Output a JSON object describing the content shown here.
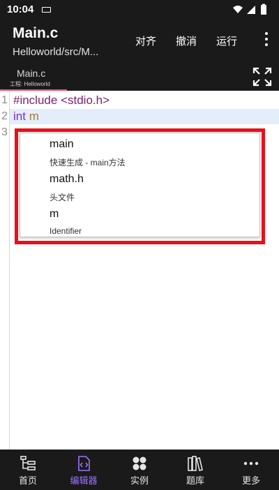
{
  "status_bar": {
    "time": "10:04"
  },
  "app_bar": {
    "title": "Main.c",
    "subtitle": "Helloworld/src/M...",
    "actions": {
      "format": "对齐",
      "undo": "撤消",
      "run": "运行"
    }
  },
  "tabs": [
    {
      "name": "Main.c",
      "project": "工程: Helloworld"
    }
  ],
  "editor": {
    "lines": [
      {
        "num": "1",
        "parts": [
          "#include",
          " ",
          "<stdio.h>"
        ]
      },
      {
        "num": "2",
        "parts": [
          "int",
          " ",
          "m"
        ]
      },
      {
        "num": "3",
        "parts": []
      }
    ]
  },
  "autocomplete": [
    {
      "label": "main",
      "desc": "快速生成 - main方法"
    },
    {
      "label": "math.h",
      "desc": "头文件"
    },
    {
      "label": "m",
      "desc": "Identifier"
    }
  ],
  "bottom_nav": [
    {
      "label": "首页",
      "icon": "home-tree-icon"
    },
    {
      "label": "编辑器",
      "icon": "code-file-icon",
      "active": true
    },
    {
      "label": "实例",
      "icon": "examples-icon"
    },
    {
      "label": "题库",
      "icon": "books-icon"
    },
    {
      "label": "更多",
      "icon": "more-dots-icon"
    }
  ],
  "colors": {
    "bar_background": "#1a1a1a",
    "active_accent": "#9d72ff",
    "tab_indicator": "#ff4d6d",
    "annotation_box": "#e8101a",
    "current_line": "#e3eefa"
  }
}
